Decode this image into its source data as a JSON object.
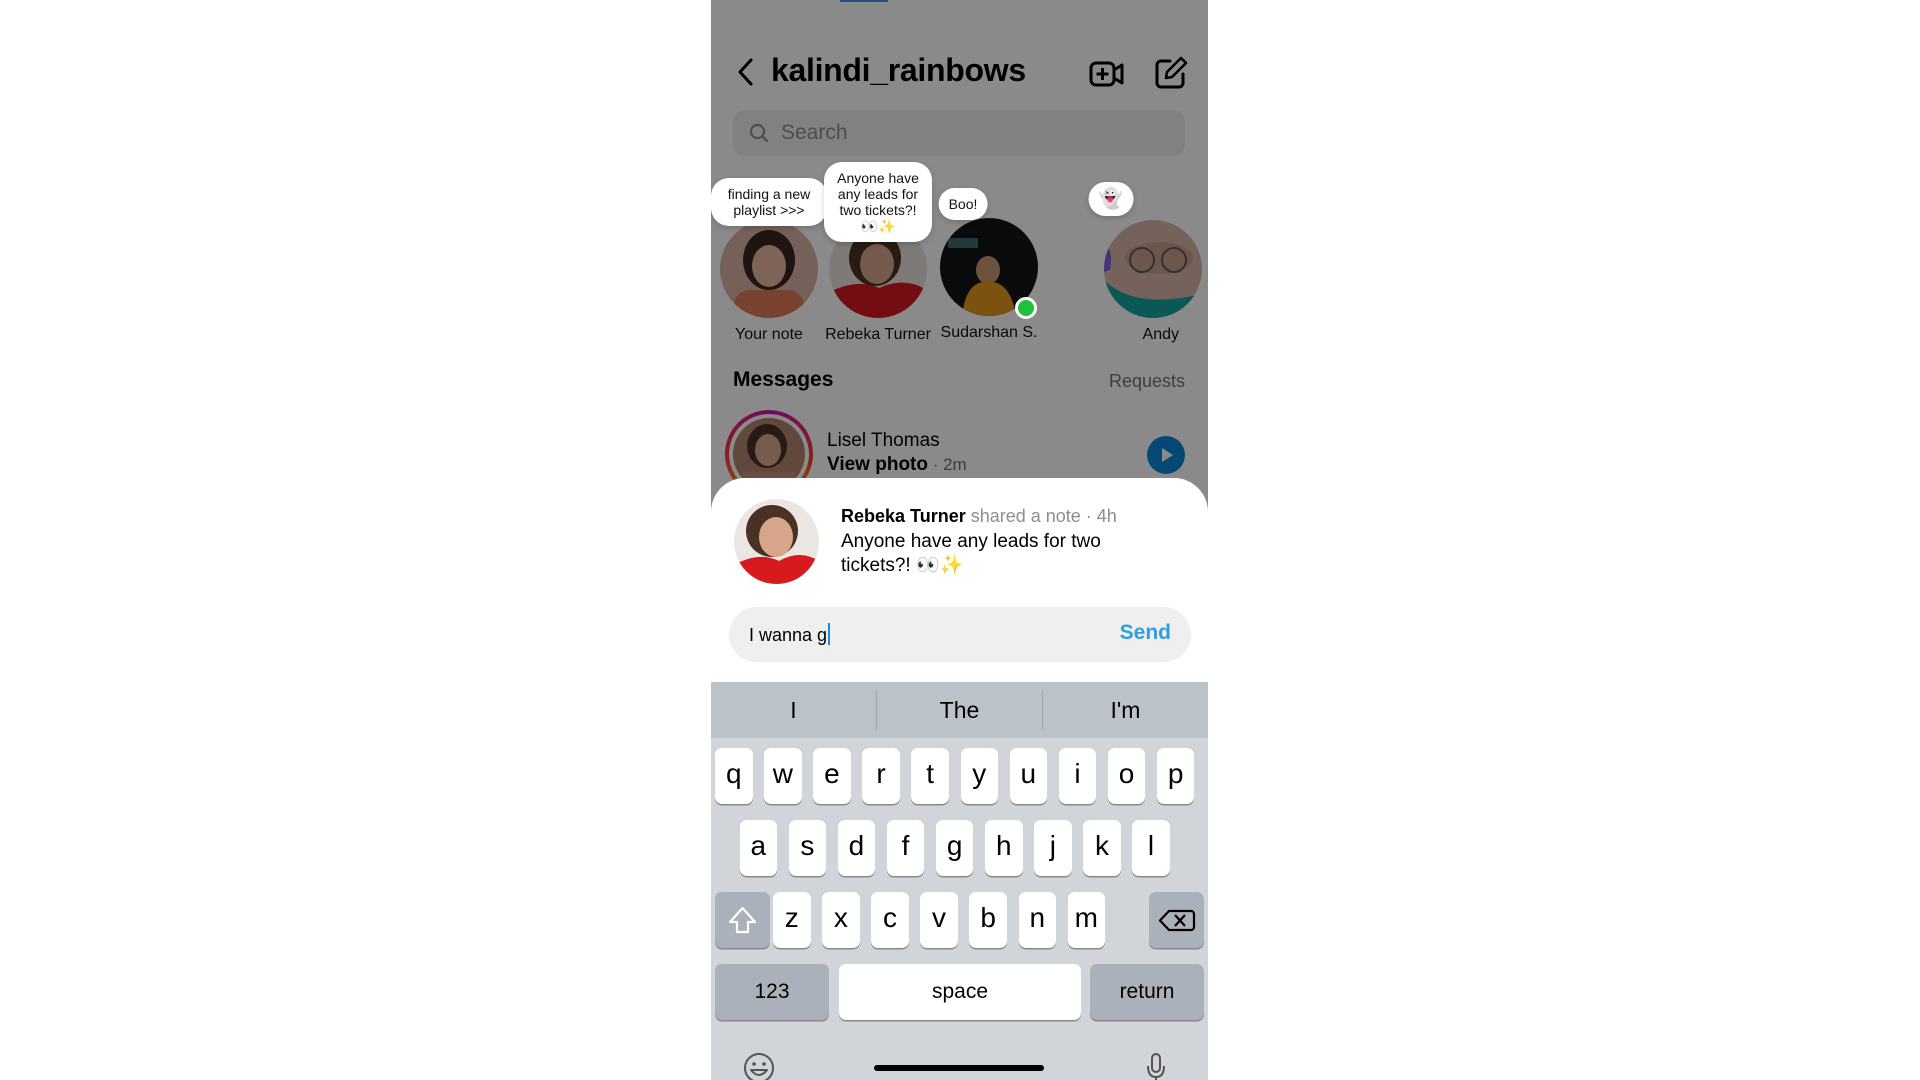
{
  "header": {
    "title": "kalindi_rainbows",
    "back_icon": "chevron-left-icon",
    "video_icon": "video-call-add-icon",
    "edit_icon": "compose-edit-icon"
  },
  "search": {
    "placeholder": "Search"
  },
  "notes": [
    {
      "text": "finding a new playlist >>>",
      "name": "Your note"
    },
    {
      "text": "Anyone have any leads for two tickets?! 👀✨",
      "name": "Rebeka Turner"
    },
    {
      "text": "Boo!",
      "name": "Sudarshan S.",
      "online": true
    },
    {
      "text": "👻",
      "name": "Andy"
    }
  ],
  "messages": {
    "heading": "Messages",
    "requests_label": "Requests",
    "items": [
      {
        "name": "Lisel Thomas",
        "action": "View photo",
        "time": " · 2m"
      }
    ]
  },
  "sheet": {
    "author": "Rebeka Turner",
    "meta": " shared a note · 4h",
    "body": "Anyone have any leads for two tickets?! 👀✨",
    "input_value": "I wanna g",
    "send_label": "Send"
  },
  "keyboard": {
    "suggestions": [
      "I",
      "The",
      "I'm"
    ],
    "row1": [
      "q",
      "w",
      "e",
      "r",
      "t",
      "y",
      "u",
      "i",
      "o",
      "p"
    ],
    "row2": [
      "a",
      "s",
      "d",
      "f",
      "g",
      "h",
      "j",
      "k",
      "l"
    ],
    "row3": [
      "z",
      "x",
      "c",
      "v",
      "b",
      "n",
      "m"
    ],
    "numbers_label": "123",
    "space_label": "space",
    "return_label": "return"
  },
  "colors": {
    "accent": "#2c9fe0",
    "online": "#1fc03a",
    "play": "#0a85d6"
  }
}
